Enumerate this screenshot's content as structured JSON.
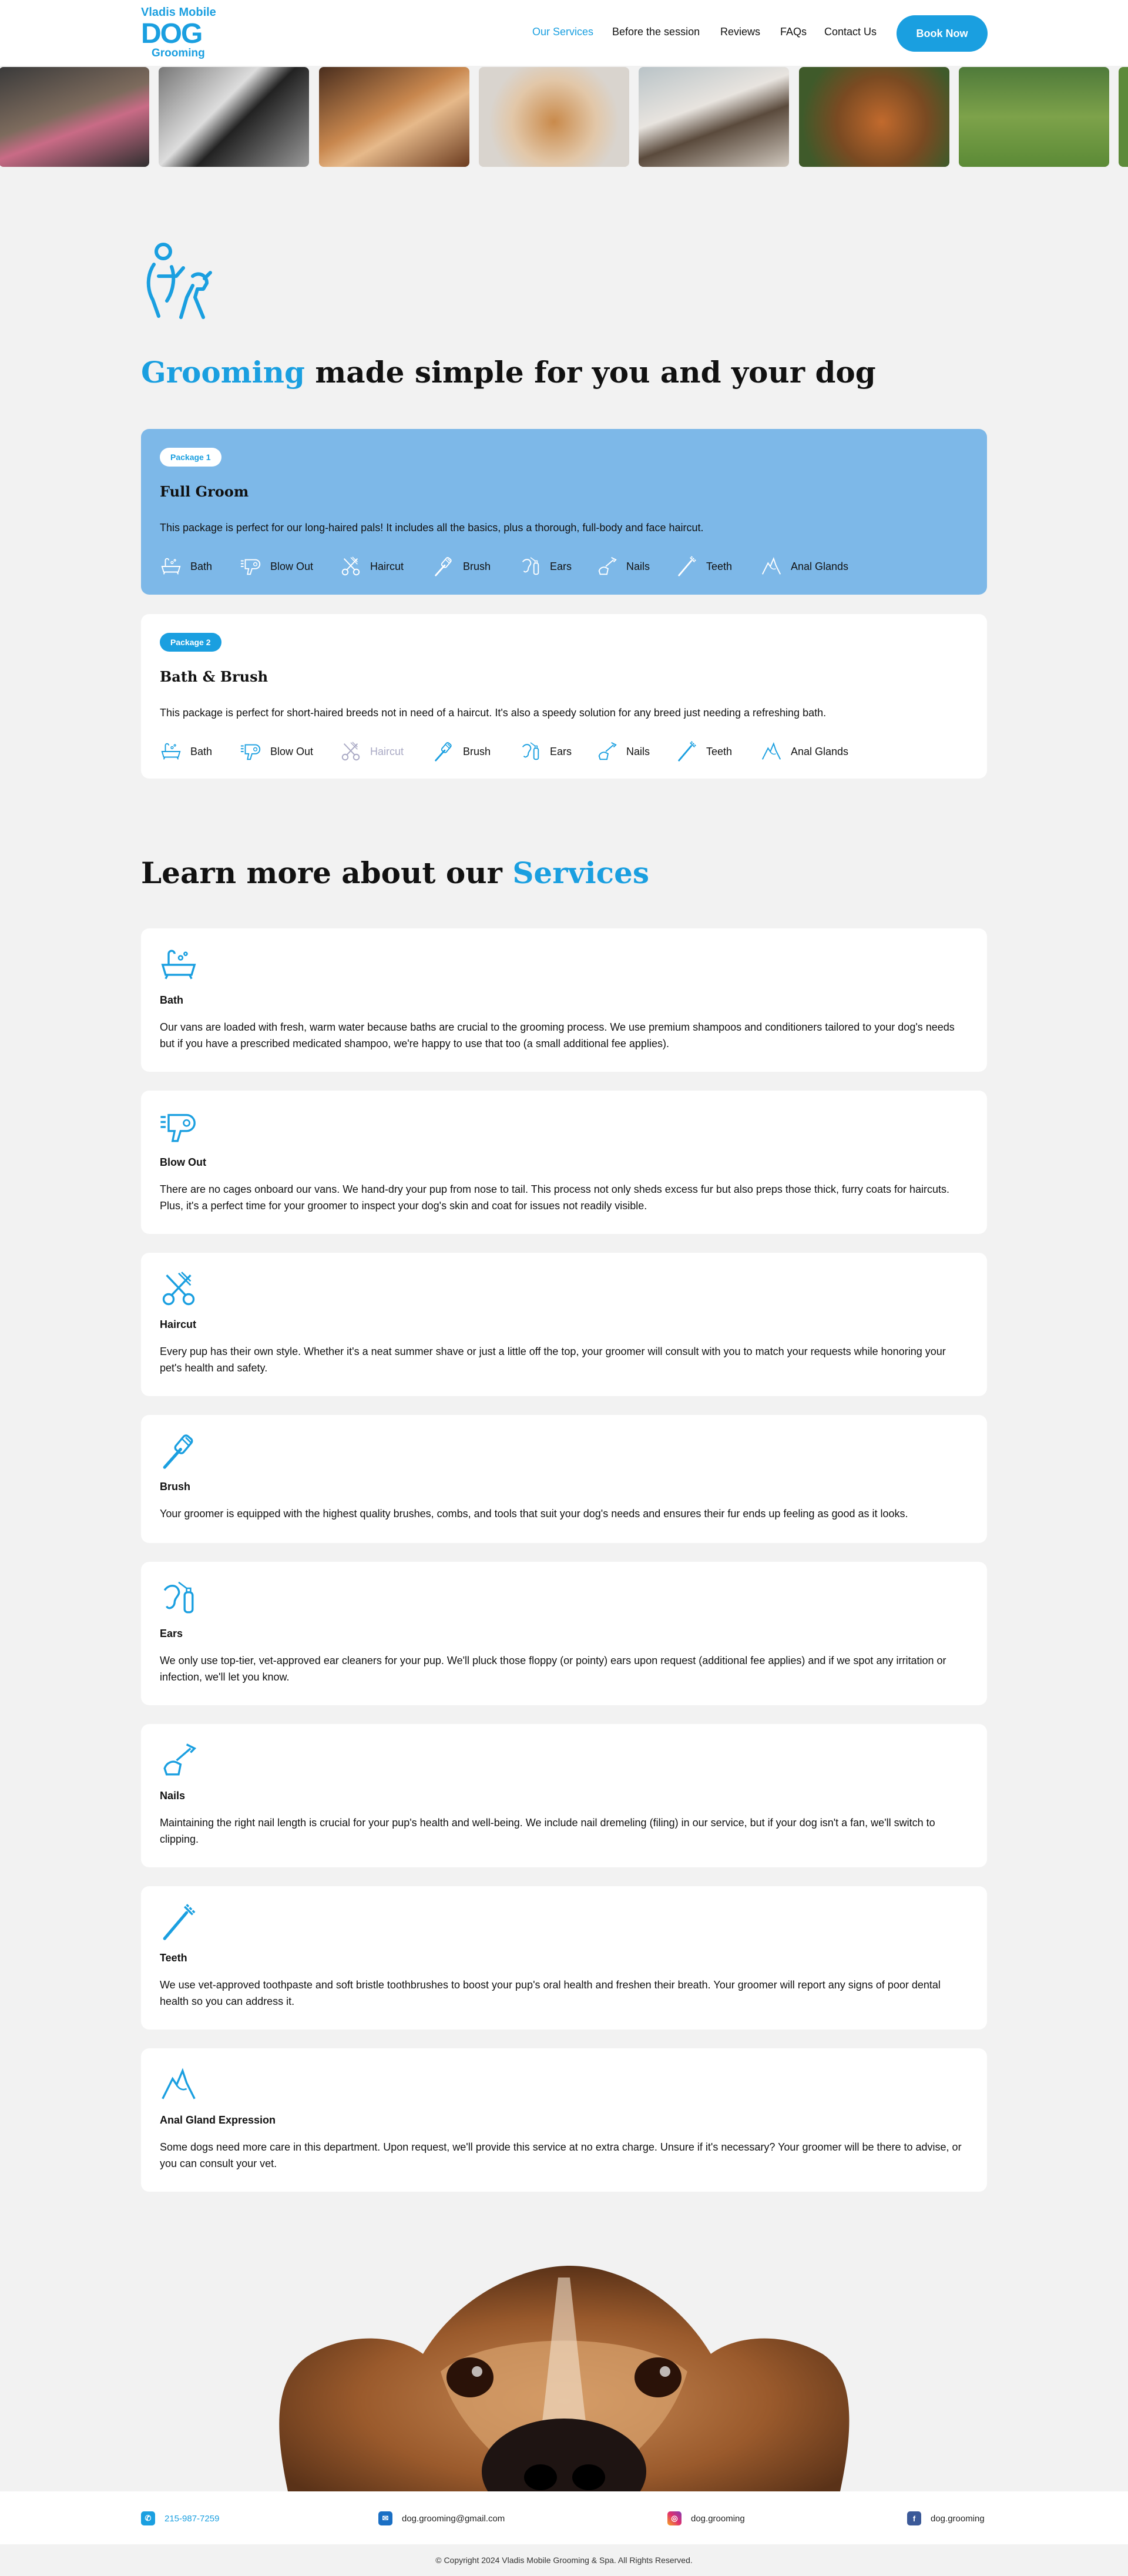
{
  "header": {
    "logo_line1": "Vladis Mobile",
    "logo_line2": "DOG",
    "logo_line3": "Grooming",
    "nav": [
      "Our Services",
      "Before the session",
      "Reviews",
      "FAQs",
      "Contact Us"
    ],
    "active_nav": "Our Services",
    "book_button": "Book Now",
    "accent_color": "#1a9fe0"
  },
  "hero": {
    "title_accent": "Grooming",
    "title_rest": " made simple for you and your dog"
  },
  "packages": [
    {
      "badge": "Package 1",
      "title": "Full Groom",
      "description": "This package is perfect for our long-haired pals! It includes all the basics, plus a thorough, full-body and face haircut.",
      "features": [
        "Bath",
        "Blow Out",
        "Haircut",
        "Brush",
        "Ears",
        "Nails",
        "Teeth",
        "Anal Glands"
      ]
    },
    {
      "badge": "Package 2",
      "title": "Bath & Brush",
      "description": "This package is perfect for short-haired breeds not in need of a haircut. It's also a speedy solution for any breed just needing a refreshing bath.",
      "features": [
        "Bath",
        "Blow Out",
        "Haircut",
        "Brush",
        "Ears",
        "Nails",
        "Teeth",
        "Anal Glands"
      ],
      "excluded": [
        "Haircut"
      ]
    }
  ],
  "services_heading": {
    "text": "Learn more about our ",
    "accent": "Services"
  },
  "services": [
    {
      "icon": "bathtub-icon",
      "title": "Bath",
      "text": "Our vans are loaded with fresh, warm water because baths are crucial to the grooming process. We use premium shampoos and conditioners tailored to your dog's needs but if you have a prescribed medicated shampoo, we're happy to use that too (a small additional fee applies)."
    },
    {
      "icon": "blow-dryer-icon",
      "title": "Blow Out",
      "text": "There are no cages onboard our vans. We hand-dry your pup from nose to tail. This process not only sheds excess fur but also preps those thick, furry coats for haircuts. Plus, it's a perfect time for your groomer to inspect your dog's skin and coat for issues not readily visible."
    },
    {
      "icon": "scissors-comb-icon",
      "title": "Haircut",
      "text": "Every pup has their own style. Whether it's a neat summer shave or just a little off the top, your groomer will consult with you to match your requests while honoring your pet's health and safety."
    },
    {
      "icon": "brush-icon",
      "title": "Brush",
      "text": "Your groomer is equipped with the highest quality brushes, combs, and tools that suit your dog's needs and ensures their fur ends up feeling as good as it looks."
    },
    {
      "icon": "ear-cleaner-icon",
      "title": "Ears",
      "text": "We only use top-tier, vet-approved ear cleaners for your pup. We'll pluck those floppy (or pointy) ears upon request (additional fee applies) and if we spot any irritation or infection, we'll let you know."
    },
    {
      "icon": "nail-grinder-icon",
      "title": "Nails",
      "text": "Maintaining the right nail length is crucial for your pup's health and well-being. We include nail dremeling (filing) in our service, but if your dog isn't a fan, we'll switch to clipping."
    },
    {
      "icon": "toothbrush-icon",
      "title": "Teeth",
      "text": "We use vet-approved toothpaste and soft bristle toothbrushes to boost your pup's oral health and freshen their breath. Your groomer will report any signs of poor dental health so you can address it."
    },
    {
      "icon": "dog-tail-icon",
      "title": "Anal Gland Expression",
      "text": "Some dogs need more care in this department. Upon request, we'll provide this service at no extra charge. Unsure if it's necessary? Your groomer will be there to advise, or you can consult your vet."
    }
  ],
  "footer": {
    "phone": "215-987-7259",
    "email": "dog.grooming@gmail.com",
    "instagram": "dog.grooming",
    "facebook": "dog.grooming",
    "copyright": "© Copyright 2024 Vladis Mobile Grooming & Spa. All Rights Reserved."
  }
}
